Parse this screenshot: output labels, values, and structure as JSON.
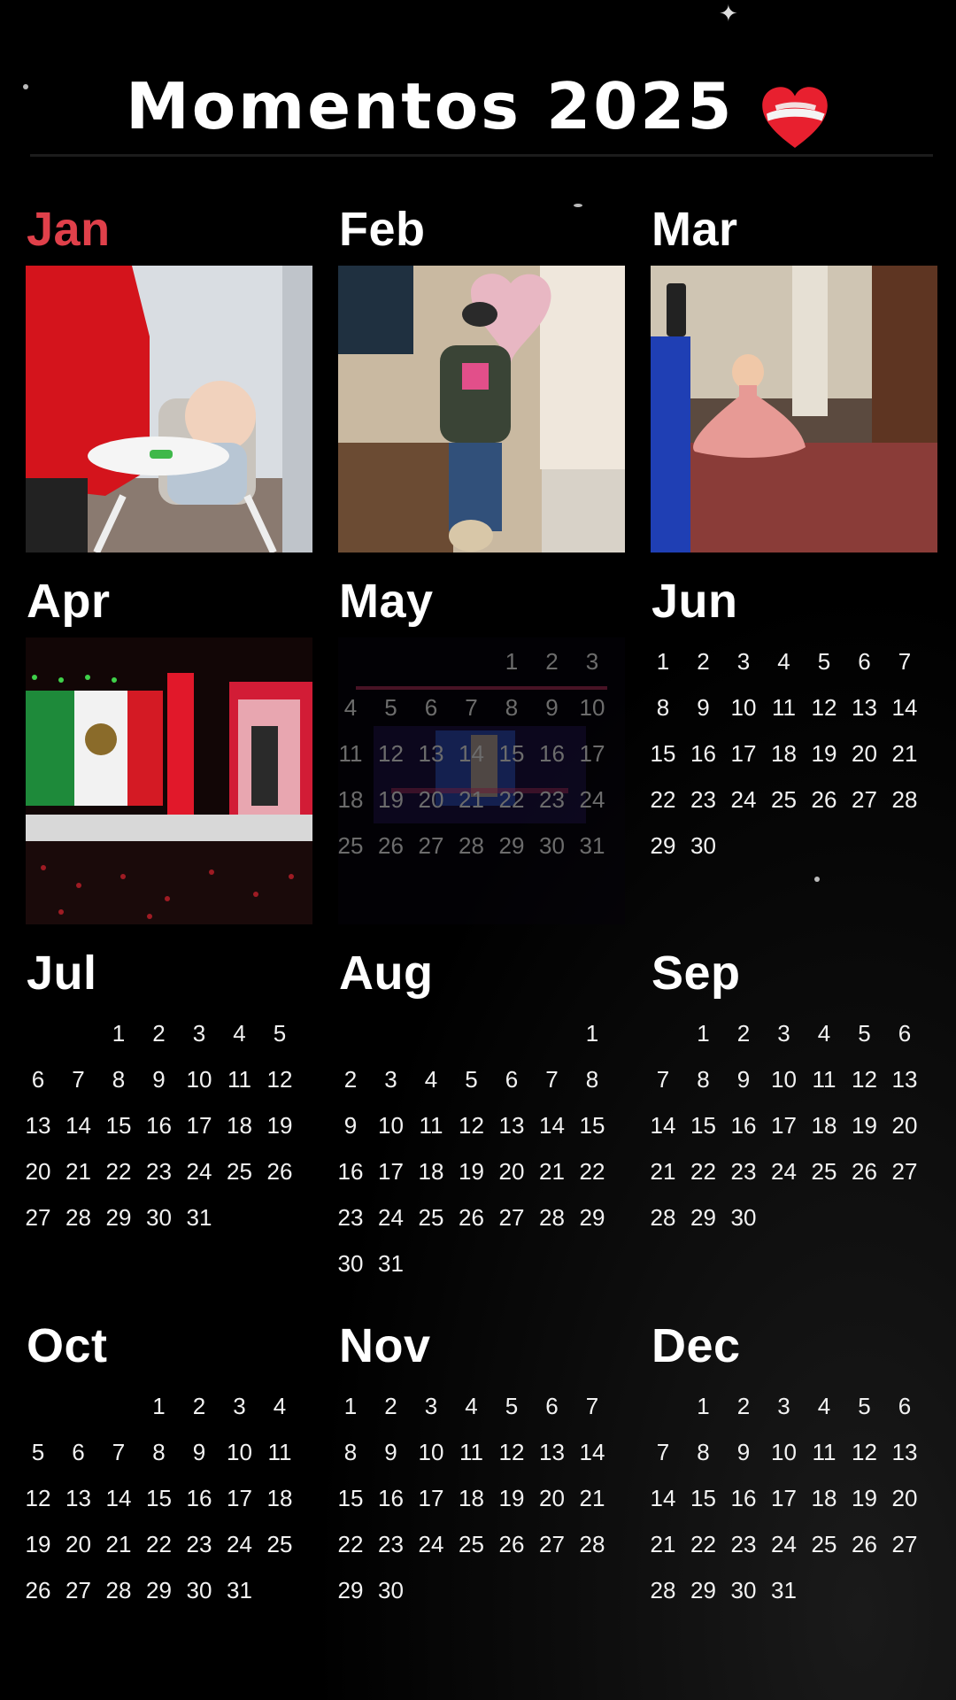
{
  "title": "Momentos 2025",
  "title_icon": "mending-heart-icon",
  "colors": {
    "background": "#000000",
    "current_month": "#e0404a",
    "text": "#ffffff"
  },
  "months": [
    {
      "name": "Jan",
      "current": true,
      "photo": "baby-in-high-chair-photo"
    },
    {
      "name": "Feb",
      "photo": "man-with-heart-balloon-photo"
    },
    {
      "name": "Mar",
      "photo": "quinceanera-dress-photo"
    },
    {
      "name": "Apr",
      "photo": "concert-mexican-flag-photo"
    },
    {
      "name": "May",
      "photo": "concert-stage-photo",
      "faded": true,
      "start": 4,
      "days": 31
    },
    {
      "name": "Jun",
      "start": 0,
      "days": 30
    },
    {
      "name": "Jul",
      "start": 2,
      "days": 31
    },
    {
      "name": "Aug",
      "start": 6,
      "days": 31
    },
    {
      "name": "Sep",
      "start": 1,
      "days": 30
    },
    {
      "name": "Oct",
      "start": 3,
      "days": 31
    },
    {
      "name": "Nov",
      "start": 0,
      "days": 30
    },
    {
      "name": "Dec",
      "start": 1,
      "days": 31
    }
  ]
}
